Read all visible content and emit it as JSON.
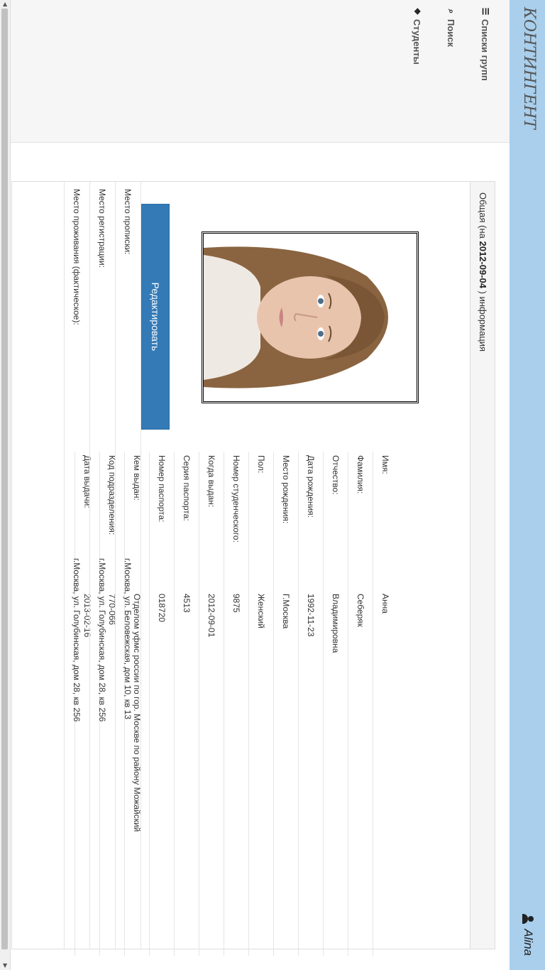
{
  "app": {
    "brand": "КОНТИНГЕНТ",
    "user": "Alina"
  },
  "nav": [
    {
      "label": "Списки групп",
      "icon": "list-icon"
    },
    {
      "label": "Поиск",
      "icon": "binoculars-icon"
    },
    {
      "label": "Студенты",
      "icon": "paw-icon"
    }
  ],
  "panel": {
    "heading_prefix": "Общая (на",
    "heading_date": "2012-09-04",
    "heading_suffix": ") информация"
  },
  "edit_label": "Редактировать",
  "fields": [
    {
      "label": "Имя:",
      "value": "Анна"
    },
    {
      "label": "Фамилия:",
      "value": "Себеряк"
    },
    {
      "label": "Отчество:",
      "value": "Владимировна"
    },
    {
      "label": "Дата рождения:",
      "value": "1992-11-23"
    },
    {
      "label": "Место рождения:",
      "value": "Г.Москва"
    },
    {
      "label": "Пол:",
      "value": "Женский"
    },
    {
      "label": "Номер студенческого:",
      "value": "9875"
    },
    {
      "label": "Когда выдан:",
      "value": "2012-09-01"
    },
    {
      "label": "Серия паспорта:",
      "value": "4513"
    },
    {
      "label": "Номер паспорта:",
      "value": "018720"
    },
    {
      "label": "Кем выдан:",
      "value": "Отделом уфмс россии по гор. Москве по району Можайский"
    },
    {
      "label": "Код подразделения:",
      "value": "770-066"
    },
    {
      "label": "Дата выдачи:",
      "value": "2013-02-16"
    }
  ],
  "address": [
    {
      "label": "Место прописки:",
      "value": "г.Москва, ул. Беловежская, дом 10, кв 13"
    },
    {
      "label": "Место регистрации:",
      "value": "г.Москва, ул. Голубинская, дом 28, кв 256"
    },
    {
      "label": "Место проживания (фактическое):",
      "value": "г.Москва, ул. Голубинская, дом 28, кв 256"
    }
  ]
}
